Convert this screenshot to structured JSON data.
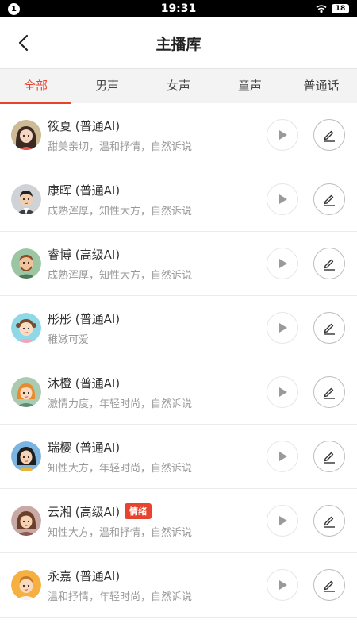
{
  "status_bar": {
    "notification_count": "1",
    "time": "19:31",
    "battery": "18"
  },
  "nav": {
    "title": "主播库"
  },
  "tabs": [
    {
      "label": "全部"
    },
    {
      "label": "男声"
    },
    {
      "label": "女声"
    },
    {
      "label": "童声"
    },
    {
      "label": "普通话"
    }
  ],
  "active_tab": "全部",
  "accent_color": "#e8432e",
  "voices": [
    {
      "name": "筱夏 (普通AI)",
      "desc": "甜美亲切，温和抒情，自然诉说",
      "tag": "",
      "avatar": "girl-long-hair"
    },
    {
      "name": "康晖 (普通AI)",
      "desc": "成熟浑厚，知性大方，自然诉说",
      "tag": "",
      "avatar": "man-suit"
    },
    {
      "name": "睿博 (高级AI)",
      "desc": "成熟浑厚，知性大方，自然诉说",
      "tag": "",
      "avatar": "man-bearded"
    },
    {
      "name": "彤彤 (普通AI)",
      "desc": "稚嫩可爱",
      "tag": "",
      "avatar": "little-girl"
    },
    {
      "name": "沐橙 (普通AI)",
      "desc": "激情力度，年轻时尚，自然诉说",
      "tag": "",
      "avatar": "girl-orange-hair"
    },
    {
      "name": "瑞樱 (普通AI)",
      "desc": "知性大方，年轻时尚，自然诉说",
      "tag": "",
      "avatar": "woman-black-hair"
    },
    {
      "name": "云湘 (高级AI)",
      "desc": "知性大方，温和抒情，自然诉说",
      "tag": "情绪",
      "avatar": "woman-brown-hair"
    },
    {
      "name": "永嘉 (普通AI)",
      "desc": "温和抒情，年轻时尚，自然诉说",
      "tag": "",
      "avatar": "boy-orange"
    }
  ]
}
